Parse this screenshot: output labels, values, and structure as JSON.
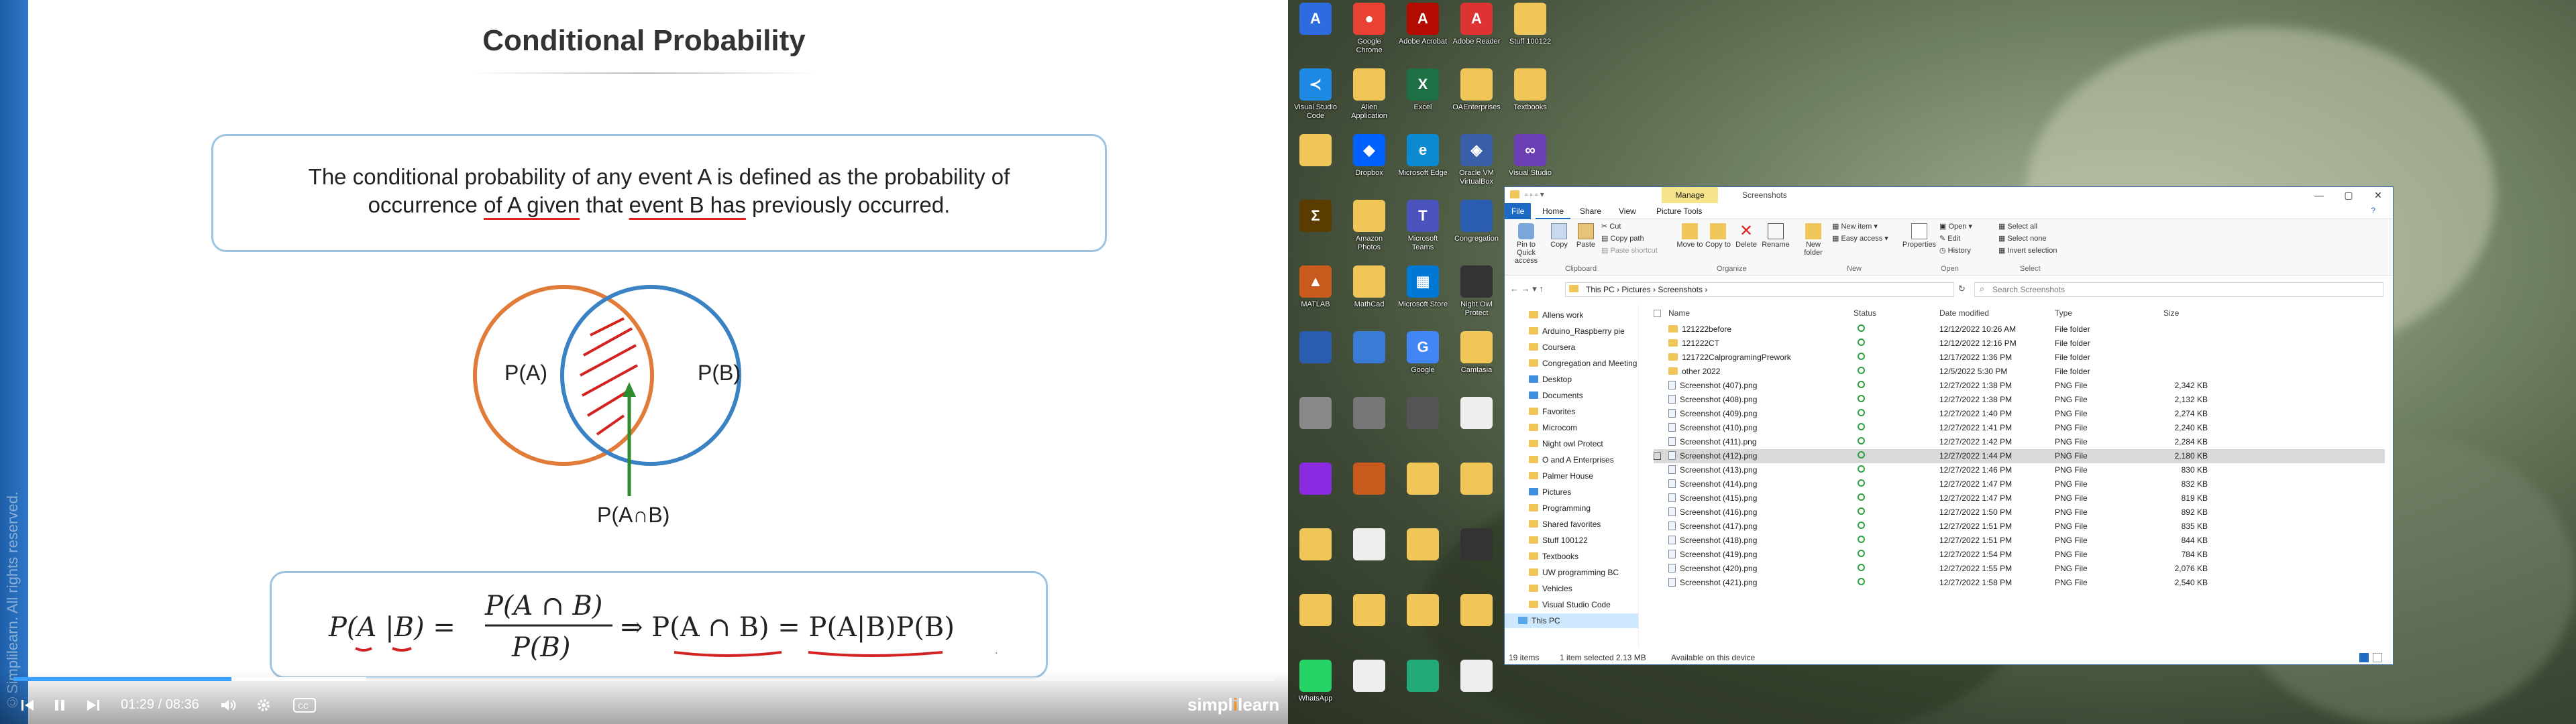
{
  "video": {
    "slide_title": "Conditional Probability",
    "definition_line1": "The conditional probability of any event A is defined as the probability of",
    "definition_line2_pre": "occurrence ",
    "definition_line2_u1": "of A given",
    "definition_line2_mid": " that ",
    "definition_line2_u2": "event B has",
    "definition_line2_post": " previously occurred.",
    "venn_a": "P(A)",
    "venn_b": "P(B)",
    "venn_intersection": "P(A∩B)",
    "formula_lhs": "P(A |B) =",
    "formula_num": "P(A ∩ B)",
    "formula_den": "P(B)",
    "formula_rhs": "⇒ P(A ∩ B) = P(A|B)P(B)",
    "watermark": "©Simplilearn. All rights reserved.",
    "current_time": "01:29",
    "time_sep": "/",
    "duration": "08:36",
    "progress": 0.173,
    "buffered": 0.28,
    "brand_a": "simpl",
    "brand_b": "i",
    "brand_c": "learn",
    "colors": {
      "accent": "#3aa0ff",
      "venn_a": "#e07b39",
      "venn_b": "#3b82c4",
      "underline": "#d22222",
      "arrow": "#2e8b2e"
    }
  },
  "desktop": {
    "icons": [
      {
        "label": "",
        "glyph": "A",
        "color": "#2d6cdf"
      },
      {
        "label": "Google Chrome",
        "glyph": "●",
        "color": "#e94235"
      },
      {
        "label": "Adobe Acrobat",
        "glyph": "A",
        "color": "#b30b00"
      },
      {
        "label": "Adobe Reader",
        "glyph": "A",
        "color": "#d33"
      },
      {
        "label": "Stuff 100122",
        "glyph": "",
        "color": "#f0c659"
      },
      {
        "label": "Visual Studio Code",
        "glyph": "≺",
        "color": "#1e88e5"
      },
      {
        "label": "Alien Application",
        "glyph": "",
        "color": "#f0c659"
      },
      {
        "label": "Excel",
        "glyph": "X",
        "color": "#1d7044"
      },
      {
        "label": "OAEnterprises",
        "glyph": "",
        "color": "#f0c659"
      },
      {
        "label": "Textbooks",
        "glyph": "",
        "color": "#f0c659"
      },
      {
        "label": "",
        "glyph": "",
        "color": "#f0c659"
      },
      {
        "label": "Dropbox",
        "glyph": "◆",
        "color": "#0061fe"
      },
      {
        "label": "Microsoft Edge",
        "glyph": "e",
        "color": "#0b8ad1"
      },
      {
        "label": "Oracle VM VirtualBox",
        "glyph": "◈",
        "color": "#3a5ea8"
      },
      {
        "label": "Visual Studio",
        "glyph": "∞",
        "color": "#6b3fb3"
      },
      {
        "label": "",
        "glyph": "Σ",
        "color": "#5a3c00"
      },
      {
        "label": "Amazon Photos",
        "glyph": "",
        "color": "#f0c659"
      },
      {
        "label": "Microsoft Teams",
        "glyph": "T",
        "color": "#4b53bc"
      },
      {
        "label": "Congregation",
        "glyph": "",
        "color": "#2a5db0"
      },
      {
        "label": "",
        "glyph": "",
        "color": "#f0c659"
      },
      {
        "label": "MATLAB",
        "glyph": "▲",
        "color": "#c85a1e"
      },
      {
        "label": "MathCad",
        "glyph": "",
        "color": "#f0c659"
      },
      {
        "label": "Microsoft Store",
        "glyph": "▦",
        "color": "#0078d4"
      },
      {
        "label": "Night Owl Protect",
        "glyph": "",
        "color": "#333"
      },
      {
        "label": "",
        "glyph": "",
        "color": "#f0c659"
      },
      {
        "label": "",
        "glyph": "",
        "color": "#2a5db0"
      },
      {
        "label": "",
        "glyph": "",
        "color": "#3a7bd5"
      },
      {
        "label": "Google",
        "glyph": "G",
        "color": "#4285f4"
      },
      {
        "label": "Camtasia",
        "glyph": "",
        "color": "#f0c659"
      },
      {
        "label": "",
        "glyph": "",
        "color": "#f0c659"
      },
      {
        "label": "",
        "glyph": "",
        "color": "#888"
      },
      {
        "label": "",
        "glyph": "",
        "color": "#777"
      },
      {
        "label": "",
        "glyph": "",
        "color": "#555"
      },
      {
        "label": "",
        "glyph": "",
        "color": "#eee"
      },
      {
        "label": "",
        "glyph": "",
        "color": "#f0c659"
      },
      {
        "label": "",
        "glyph": "",
        "color": "#8a2be2"
      },
      {
        "label": "",
        "glyph": "",
        "color": "#c85a1e"
      },
      {
        "label": "",
        "glyph": "",
        "color": "#f0c659"
      },
      {
        "label": "",
        "glyph": "",
        "color": "#f0c659"
      },
      {
        "label": "",
        "glyph": "",
        "color": "#f0c659"
      },
      {
        "label": "",
        "glyph": "",
        "color": "#f0c659"
      },
      {
        "label": "",
        "glyph": "",
        "color": "#eee"
      },
      {
        "label": "",
        "glyph": "",
        "color": "#f0c659"
      },
      {
        "label": "",
        "glyph": "",
        "color": "#333"
      },
      {
        "label": "",
        "glyph": "",
        "color": "#1e88e5"
      },
      {
        "label": "",
        "glyph": "",
        "color": "#f0c659"
      },
      {
        "label": "",
        "glyph": "",
        "color": "#f0c659"
      },
      {
        "label": "",
        "glyph": "",
        "color": "#f0c659"
      },
      {
        "label": "",
        "glyph": "",
        "color": "#f0c659"
      },
      {
        "label": "",
        "glyph": "",
        "color": "#f0c659"
      },
      {
        "label": "WhatsApp",
        "glyph": "",
        "color": "#25d366"
      },
      {
        "label": "",
        "glyph": "",
        "color": "#eee"
      },
      {
        "label": "",
        "glyph": "",
        "color": "#2a7"
      },
      {
        "label": "",
        "glyph": "",
        "color": "#eee"
      }
    ]
  },
  "explorer": {
    "manage_tab": "Manage",
    "window_title": "Screenshots",
    "tabs": [
      "File",
      "Home",
      "Share",
      "View",
      "Picture Tools"
    ],
    "ribbon": {
      "pin": "Pin to Quick access",
      "copy": "Copy",
      "paste": "Paste",
      "cut": "Cut",
      "copy_path": "Copy path",
      "paste_shortcut": "Paste shortcut",
      "move_to": "Move to",
      "copy_to": "Copy to",
      "delete": "Delete",
      "rename": "Rename",
      "new_folder": "New folder",
      "new_item": "New item",
      "easy_access": "Easy access",
      "properties": "Properties",
      "open": "Open",
      "edit": "Edit",
      "history": "History",
      "select_all": "Select all",
      "select_none": "Select none",
      "invert_selection": "Invert selection",
      "groups": [
        "Clipboard",
        "Organize",
        "New",
        "Open",
        "Select"
      ]
    },
    "breadcrumb": "This PC  ›  Pictures  ›  Screenshots  ›",
    "search_placeholder": "Search Screenshots",
    "nav": [
      {
        "label": "Allens work",
        "kind": "folder"
      },
      {
        "label": "Arduino_Raspberry pie",
        "kind": "folder"
      },
      {
        "label": "Coursera",
        "kind": "folder"
      },
      {
        "label": "Congregation and Meeting",
        "kind": "folder"
      },
      {
        "label": "Desktop",
        "kind": "blue"
      },
      {
        "label": "Documents",
        "kind": "blue"
      },
      {
        "label": "Favorites",
        "kind": "folder"
      },
      {
        "label": "Microcom",
        "kind": "folder"
      },
      {
        "label": "Night owl Protect",
        "kind": "folder"
      },
      {
        "label": "O and A Enterprises",
        "kind": "folder"
      },
      {
        "label": "Palmer House",
        "kind": "folder"
      },
      {
        "label": "Pictures",
        "kind": "blue"
      },
      {
        "label": "Programming",
        "kind": "folder"
      },
      {
        "label": "Shared favorites",
        "kind": "folder"
      },
      {
        "label": "Stuff 100122",
        "kind": "folder"
      },
      {
        "label": "Textbooks",
        "kind": "folder"
      },
      {
        "label": "UW programming BC",
        "kind": "folder"
      },
      {
        "label": "Vehicles",
        "kind": "folder"
      },
      {
        "label": "Visual Studio Code",
        "kind": "folder"
      },
      {
        "label": "This PC",
        "kind": "pc"
      }
    ],
    "columns": {
      "name": "Name",
      "status": "Status",
      "date": "Date modified",
      "type": "Type",
      "size": "Size"
    },
    "files": [
      {
        "name": "121222before",
        "date": "12/12/2022 10:26 AM",
        "type": "File folder",
        "size": "",
        "folder": true
      },
      {
        "name": "121222CT",
        "date": "12/12/2022 12:16 PM",
        "type": "File folder",
        "size": "",
        "folder": true
      },
      {
        "name": "121722CalprogramingPrework",
        "date": "12/17/2022 1:36 PM",
        "type": "File folder",
        "size": "",
        "folder": true
      },
      {
        "name": "other 2022",
        "date": "12/5/2022 5:30 PM",
        "type": "File folder",
        "size": "",
        "folder": true
      },
      {
        "name": "Screenshot (407).png",
        "date": "12/27/2022 1:38 PM",
        "type": "PNG File",
        "size": "2,342 KB",
        "folder": false
      },
      {
        "name": "Screenshot (408).png",
        "date": "12/27/2022 1:38 PM",
        "type": "PNG File",
        "size": "2,132 KB",
        "folder": false
      },
      {
        "name": "Screenshot (409).png",
        "date": "12/27/2022 1:40 PM",
        "type": "PNG File",
        "size": "2,274 KB",
        "folder": false
      },
      {
        "name": "Screenshot (410).png",
        "date": "12/27/2022 1:41 PM",
        "type": "PNG File",
        "size": "2,240 KB",
        "folder": false
      },
      {
        "name": "Screenshot (411).png",
        "date": "12/27/2022 1:42 PM",
        "type": "PNG File",
        "size": "2,284 KB",
        "folder": false
      },
      {
        "name": "Screenshot (412).png",
        "date": "12/27/2022 1:44 PM",
        "type": "PNG File",
        "size": "2,180 KB",
        "folder": false,
        "selected": true
      },
      {
        "name": "Screenshot (413).png",
        "date": "12/27/2022 1:46 PM",
        "type": "PNG File",
        "size": "830 KB",
        "folder": false
      },
      {
        "name": "Screenshot (414).png",
        "date": "12/27/2022 1:47 PM",
        "type": "PNG File",
        "size": "832 KB",
        "folder": false
      },
      {
        "name": "Screenshot (415).png",
        "date": "12/27/2022 1:47 PM",
        "type": "PNG File",
        "size": "819 KB",
        "folder": false
      },
      {
        "name": "Screenshot (416).png",
        "date": "12/27/2022 1:50 PM",
        "type": "PNG File",
        "size": "892 KB",
        "folder": false
      },
      {
        "name": "Screenshot (417).png",
        "date": "12/27/2022 1:51 PM",
        "type": "PNG File",
        "size": "835 KB",
        "folder": false
      },
      {
        "name": "Screenshot (418).png",
        "date": "12/27/2022 1:51 PM",
        "type": "PNG File",
        "size": "844 KB",
        "folder": false
      },
      {
        "name": "Screenshot (419).png",
        "date": "12/27/2022 1:54 PM",
        "type": "PNG File",
        "size": "784 KB",
        "folder": false
      },
      {
        "name": "Screenshot (420).png",
        "date": "12/27/2022 1:55 PM",
        "type": "PNG File",
        "size": "2,076 KB",
        "folder": false
      },
      {
        "name": "Screenshot (421).png",
        "date": "12/27/2022 1:58 PM",
        "type": "PNG File",
        "size": "2,540 KB",
        "folder": false
      }
    ],
    "status_items": "19 items",
    "status_selected": "1 item selected  2.13 MB",
    "status_available": "Available on this device"
  }
}
